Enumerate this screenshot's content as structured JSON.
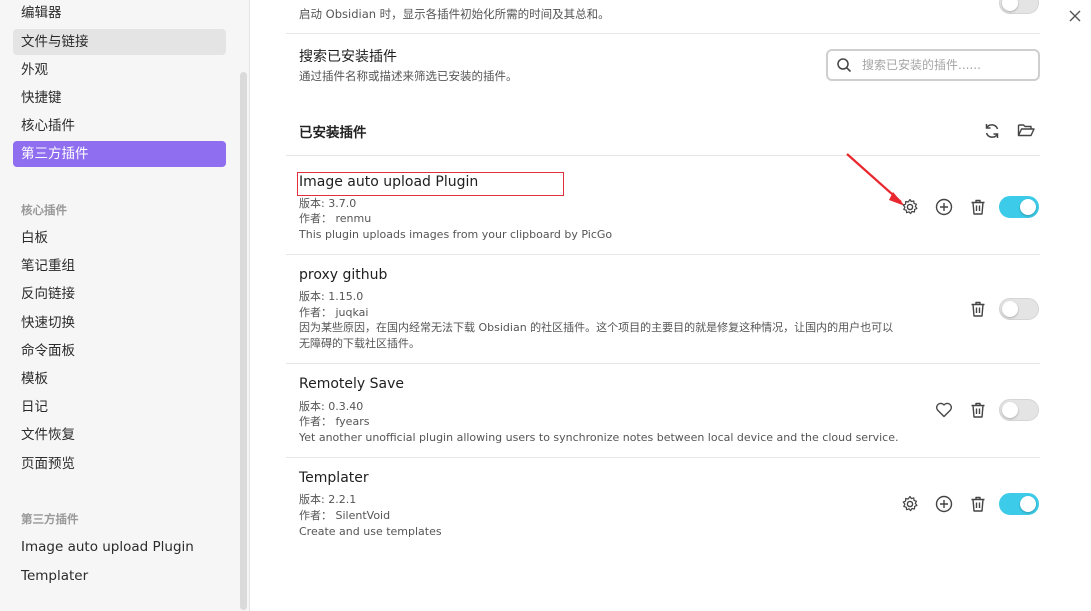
{
  "sidebar": {
    "items_top": [
      {
        "label": "编辑器"
      },
      {
        "label": "文件与链接"
      },
      {
        "label": "外观"
      },
      {
        "label": "快捷键"
      },
      {
        "label": "核心插件"
      },
      {
        "label": "第三方插件"
      }
    ],
    "core_heading": "核心插件",
    "core_items": [
      {
        "label": "白板"
      },
      {
        "label": "笔记重组"
      },
      {
        "label": "反向链接"
      },
      {
        "label": "快速切换"
      },
      {
        "label": "命令面板"
      },
      {
        "label": "模板"
      },
      {
        "label": "日记"
      },
      {
        "label": "文件恢复"
      },
      {
        "label": "页面预览"
      }
    ],
    "third_heading": "第三方插件",
    "third_items": [
      {
        "label": "Image auto upload Plugin"
      },
      {
        "label": "Templater"
      }
    ]
  },
  "main": {
    "startup_desc": "启动 Obsidian 时，显示各插件初始化所需的时间及其总和。",
    "search": {
      "title": "搜索已安装插件",
      "desc": "通过插件名称或描述来筛选已安装的插件。",
      "placeholder": "搜索已安装的插件......"
    },
    "installed_title": "已安装插件",
    "plugins": [
      {
        "name": "Image auto upload Plugin",
        "version": "版本: 3.7.0",
        "author": "作者： renmu",
        "desc": "This plugin uploads images from your clipboard by PicGo",
        "enabled": true
      },
      {
        "name": "proxy github",
        "version": "版本: 1.15.0",
        "author": "作者： juqkai",
        "desc": "因为某些原因，在国内经常无法下载 Obsidian 的社区插件。这个项目的主要目的就是修复这种情况，让国内的用户也可以",
        "desc2": "无障碍的下载社区插件。",
        "enabled": false
      },
      {
        "name": "Remotely Save",
        "version": "版本: 0.3.40",
        "author": "作者： fyears",
        "desc": "Yet another unofficial plugin allowing users to synchronize notes between local device and the cloud service.",
        "enabled": false
      },
      {
        "name": "Templater",
        "version": "版本: 2.2.1",
        "author": "作者： SilentVoid",
        "desc": "Create and use templates",
        "enabled": true
      }
    ]
  },
  "colors": {
    "accent": "#8f6ef0",
    "toggle_on": "#3ccbe8",
    "highlight_box": "#e0313a"
  }
}
